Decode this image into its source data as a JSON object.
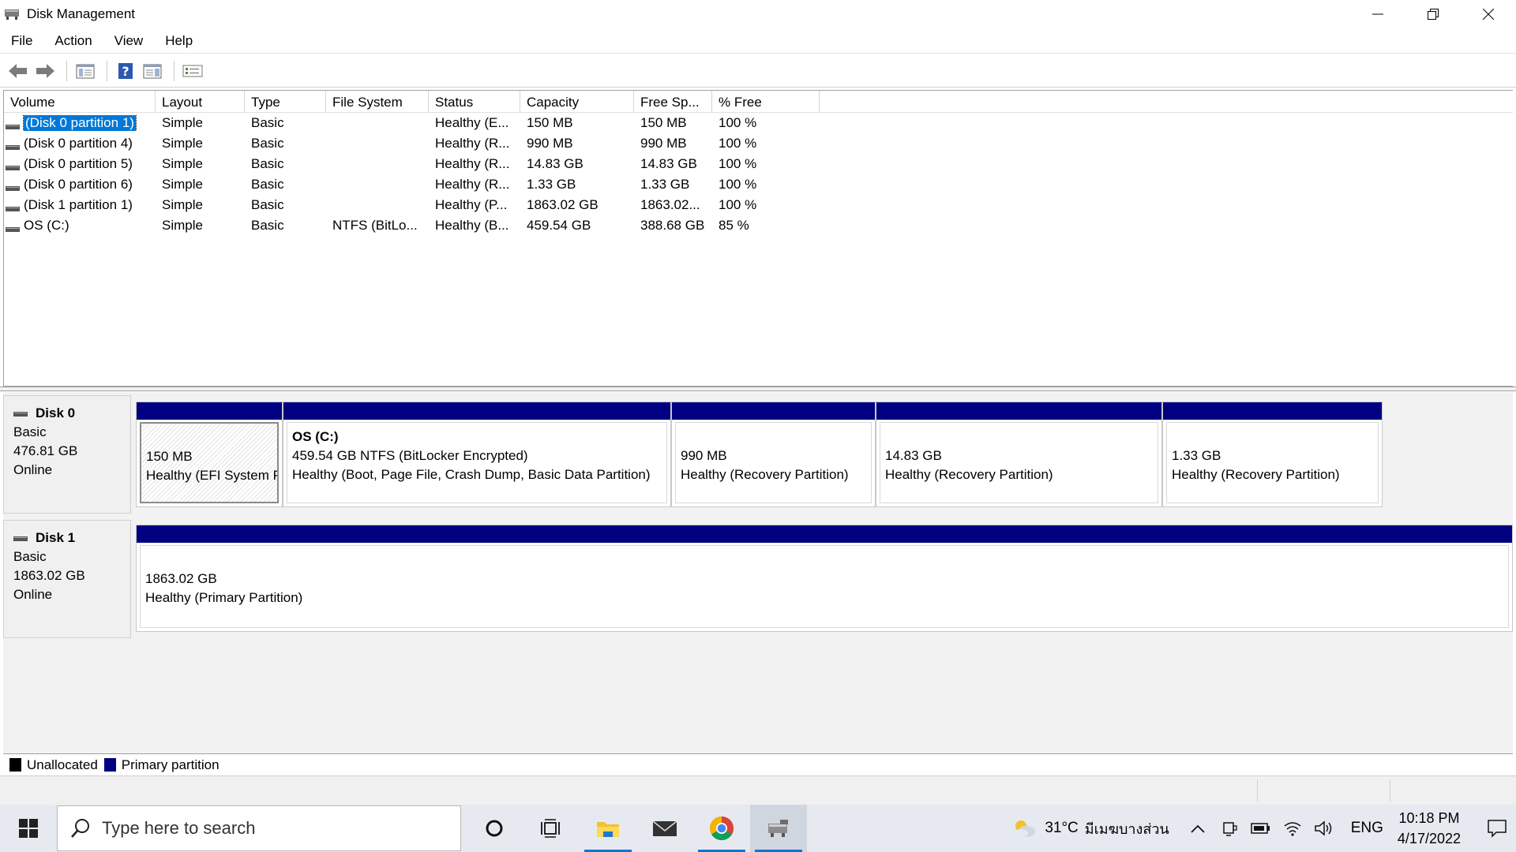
{
  "window": {
    "title": "Disk Management",
    "controls": [
      "minimize",
      "restore",
      "close"
    ]
  },
  "menu": [
    "File",
    "Action",
    "View",
    "Help"
  ],
  "toolbar": {
    "buttons": [
      "back-icon",
      "forward-icon",
      "show-hide-console-tree-icon",
      "help-icon",
      "properties-view-icon",
      "settings-list-icon"
    ]
  },
  "volume_table": {
    "columns": [
      "Volume",
      "Layout",
      "Type",
      "File System",
      "Status",
      "Capacity",
      "Free Sp...",
      "% Free"
    ],
    "rows": [
      {
        "volume": "(Disk 0 partition 1)",
        "layout": "Simple",
        "type": "Basic",
        "fs": "",
        "status": "Healthy (E...",
        "capacity": "150 MB",
        "free": "150 MB",
        "pct": "100 %",
        "selected": true
      },
      {
        "volume": "(Disk 0 partition 4)",
        "layout": "Simple",
        "type": "Basic",
        "fs": "",
        "status": "Healthy (R...",
        "capacity": "990 MB",
        "free": "990 MB",
        "pct": "100 %"
      },
      {
        "volume": "(Disk 0 partition 5)",
        "layout": "Simple",
        "type": "Basic",
        "fs": "",
        "status": "Healthy (R...",
        "capacity": "14.83 GB",
        "free": "14.83 GB",
        "pct": "100 %"
      },
      {
        "volume": "(Disk 0 partition 6)",
        "layout": "Simple",
        "type": "Basic",
        "fs": "",
        "status": "Healthy (R...",
        "capacity": "1.33 GB",
        "free": "1.33 GB",
        "pct": "100 %"
      },
      {
        "volume": "(Disk 1 partition 1)",
        "layout": "Simple",
        "type": "Basic",
        "fs": "",
        "status": "Healthy (P...",
        "capacity": "1863.02 GB",
        "free": "1863.02...",
        "pct": "100 %"
      },
      {
        "volume": "OS (C:)",
        "layout": "Simple",
        "type": "Basic",
        "fs": "NTFS (BitLo...",
        "status": "Healthy (B...",
        "capacity": "459.54 GB",
        "free": "388.68 GB",
        "pct": "85 %"
      }
    ]
  },
  "disks": [
    {
      "name": "Disk 0",
      "type": "Basic",
      "size": "476.81 GB",
      "state": "Online",
      "partitions": [
        {
          "title": "",
          "line1": "150 MB",
          "line2": "Healthy (EFI System P",
          "hatched": true
        },
        {
          "title": "OS  (C:)",
          "line1": "459.54 GB NTFS (BitLocker Encrypted)",
          "line2": "Healthy (Boot, Page File, Crash Dump, Basic Data Partition)"
        },
        {
          "title": "",
          "line1": "990 MB",
          "line2": "Healthy (Recovery Partition)"
        },
        {
          "title": "",
          "line1": "14.83 GB",
          "line2": "Healthy (Recovery Partition)"
        },
        {
          "title": "",
          "line1": "1.33 GB",
          "line2": "Healthy (Recovery Partition)"
        }
      ]
    },
    {
      "name": "Disk 1",
      "type": "Basic",
      "size": "1863.02 GB",
      "state": "Online",
      "partitions": [
        {
          "title": "",
          "line1": "1863.02 GB",
          "line2": "Healthy (Primary Partition)"
        }
      ]
    }
  ],
  "legend": [
    {
      "label": "Unallocated",
      "color": "#000000"
    },
    {
      "label": "Primary partition",
      "color": "#000080"
    }
  ],
  "taskbar": {
    "search_placeholder": "Type here to search",
    "apps": [
      "cortana-icon",
      "task-view-icon",
      "file-explorer-icon",
      "mail-icon",
      "chrome-icon",
      "disk-management-icon"
    ],
    "weather_temp": "31°C",
    "weather_location": "มีเมฆบางส่วน",
    "language": "ENG",
    "time": "10:18 PM",
    "date": "4/17/2022"
  }
}
